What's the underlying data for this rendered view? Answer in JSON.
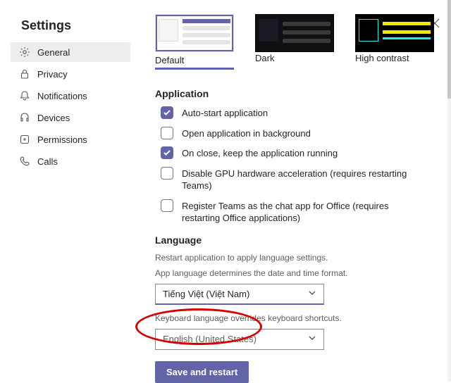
{
  "title": "Settings",
  "sidebar": {
    "items": [
      {
        "label": "General"
      },
      {
        "label": "Privacy"
      },
      {
        "label": "Notifications"
      },
      {
        "label": "Devices"
      },
      {
        "label": "Permissions"
      },
      {
        "label": "Calls"
      }
    ]
  },
  "themes": {
    "default": "Default",
    "dark": "Dark",
    "hc": "High contrast"
  },
  "application": {
    "heading": "Application",
    "items": [
      {
        "label": "Auto-start application",
        "checked": true
      },
      {
        "label": "Open application in background",
        "checked": false
      },
      {
        "label": "On close, keep the application running",
        "checked": true
      },
      {
        "label": "Disable GPU hardware acceleration (requires restarting Teams)",
        "checked": false
      },
      {
        "label": "Register Teams as the chat app for Office (requires restarting Office applications)",
        "checked": false
      }
    ]
  },
  "language": {
    "heading": "Language",
    "restart_hint": "Restart application to apply language settings.",
    "app_lang_hint": "App language determines the date and time format.",
    "app_lang_value": "Tiếng Việt (Việt Nam)",
    "kbd_hint": "Keyboard language overrides keyboard shortcuts.",
    "kbd_value": "English (United States)"
  },
  "save_restart": "Save and restart"
}
